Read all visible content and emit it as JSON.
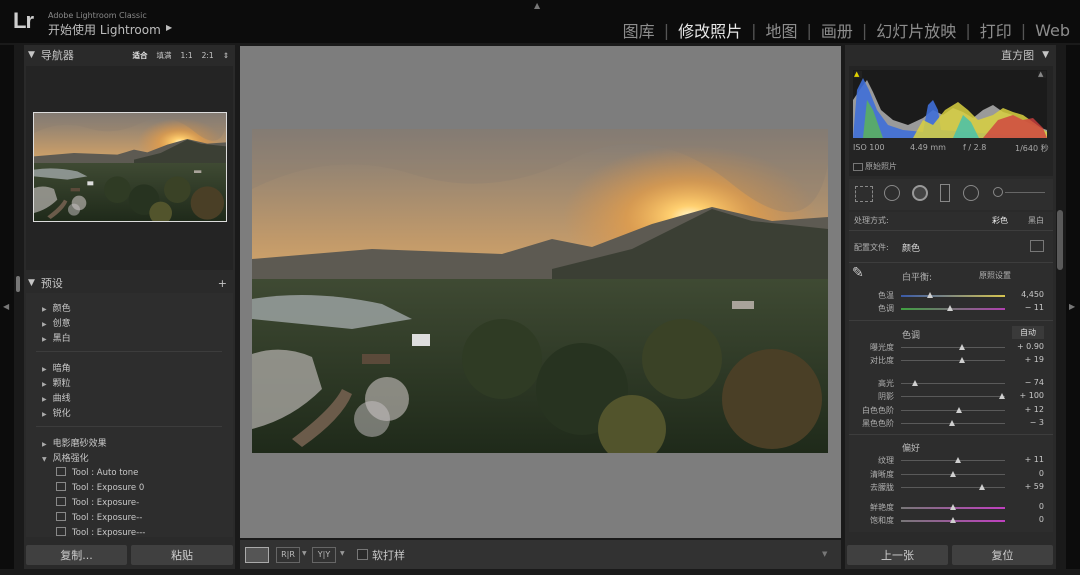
{
  "topbar": {
    "logo": "Lr",
    "brand_small": "Adobe Lightroom Classic",
    "brand_main": "开始使用 Lightroom",
    "brand_arrow": "▶",
    "modules": [
      "图库",
      "修改照片",
      "地图",
      "画册",
      "幻灯片放映",
      "打印",
      "Web"
    ],
    "active_module": "修改照片"
  },
  "navigator": {
    "title": "导航器",
    "zoom_options": [
      "适合",
      "填满",
      "1:1",
      "2:1"
    ],
    "zoom_active": "适合"
  },
  "presets": {
    "title": "预设",
    "add": "+",
    "groups1": [
      "颜色",
      "创意",
      "黑白"
    ],
    "groups2": [
      "暗角",
      "颗粒",
      "曲线",
      "锐化"
    ],
    "groups3": [
      "电影磨砂效果"
    ],
    "expanded_group": "风格强化",
    "expanded_items": [
      "Tool : Auto tone",
      "Tool : Exposure 0",
      "Tool : Exposure-",
      "Tool : Exposure--",
      "Tool : Exposure---"
    ]
  },
  "left_buttons": {
    "copy": "复制...",
    "paste": "粘贴"
  },
  "toolbar": {
    "soft_proof": "软打样"
  },
  "histogram": {
    "title": "直方图",
    "iso": "ISO 100",
    "focal": "4.49 mm",
    "aperture": "f / 2.8",
    "shutter": "1/640 秒",
    "original_photo": "原始照片"
  },
  "basic": {
    "treatment_label": "处理方式:",
    "treatment_color": "彩色",
    "treatment_bw": "黑白",
    "profile_label": "配置文件:",
    "profile_value": "颜色",
    "wb_label": "白平衡:",
    "wb_value": "原照设置",
    "tone_title": "色调",
    "auto": "自动",
    "presence_title": "偏好",
    "sliders": [
      {
        "name": "色温",
        "value": "4,450",
        "pos": 0.28
      },
      {
        "name": "色调",
        "value": "− 11",
        "pos": 0.47
      },
      {
        "name": "曝光度",
        "value": "+ 0.90",
        "pos": 0.59
      },
      {
        "name": "对比度",
        "value": "+ 19",
        "pos": 0.59
      },
      {
        "name": "高光",
        "value": "− 74",
        "pos": 0.13
      },
      {
        "name": "阴影",
        "value": "+ 100",
        "pos": 0.97
      },
      {
        "name": "白色色阶",
        "value": "+ 12",
        "pos": 0.56
      },
      {
        "name": "黑色色阶",
        "value": "− 3",
        "pos": 0.49
      },
      {
        "name": "纹理",
        "value": "+ 11",
        "pos": 0.55
      },
      {
        "name": "清晰度",
        "value": "0",
        "pos": 0.5
      },
      {
        "name": "去朦胧",
        "value": "+ 59",
        "pos": 0.78
      },
      {
        "name": "鲜艳度",
        "value": "0",
        "pos": 0.5
      },
      {
        "name": "饱和度",
        "value": "0",
        "pos": 0.5
      }
    ]
  },
  "right_buttons": {
    "prev": "上一张",
    "reset": "复位"
  }
}
